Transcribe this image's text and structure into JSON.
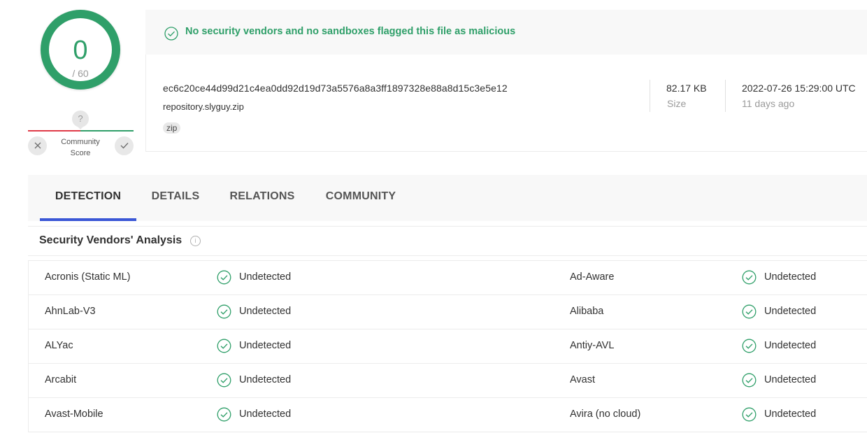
{
  "score": {
    "value": "0",
    "total": "/ 60"
  },
  "community": {
    "question": "?",
    "label_line1": "Community",
    "label_line2": "Score",
    "down_icon": "close-icon",
    "up_icon": "check-icon"
  },
  "banner": {
    "message": "No security vendors and no sandboxes flagged this file as malicious",
    "icon": "check-circle-icon"
  },
  "file": {
    "hash": "ec6c20ce44d99d21c4ea0dd92d19d73a5576a8a3ff1897328e88a8d15c3e5e12",
    "name": "repository.slyguy.zip",
    "tag": "zip",
    "size_value": "82.17 KB",
    "size_label": "Size",
    "date_value": "2022-07-26 15:29:00 UTC",
    "date_label": "11 days ago"
  },
  "tabs": [
    {
      "label": "DETECTION",
      "active": true
    },
    {
      "label": "DETAILS",
      "active": false
    },
    {
      "label": "RELATIONS",
      "active": false
    },
    {
      "label": "COMMUNITY",
      "active": false
    }
  ],
  "analysis": {
    "title": "Security Vendors' Analysis",
    "info_icon": "info-icon",
    "rows": [
      {
        "left_vendor": "Acronis (Static ML)",
        "left_result": "Undetected",
        "right_vendor": "Ad-Aware",
        "right_result": "Undetected"
      },
      {
        "left_vendor": "AhnLab-V3",
        "left_result": "Undetected",
        "right_vendor": "Alibaba",
        "right_result": "Undetected"
      },
      {
        "left_vendor": "ALYac",
        "left_result": "Undetected",
        "right_vendor": "Antiy-AVL",
        "right_result": "Undetected"
      },
      {
        "left_vendor": "Arcabit",
        "left_result": "Undetected",
        "right_vendor": "Avast",
        "right_result": "Undetected"
      },
      {
        "left_vendor": "Avast-Mobile",
        "left_result": "Undetected",
        "right_vendor": "Avira (no cloud)",
        "right_result": "Undetected"
      }
    ]
  },
  "colors": {
    "clean_green": "#2f9f69",
    "malicious_red": "#e03a48",
    "tab_accent": "#3b57d6"
  }
}
